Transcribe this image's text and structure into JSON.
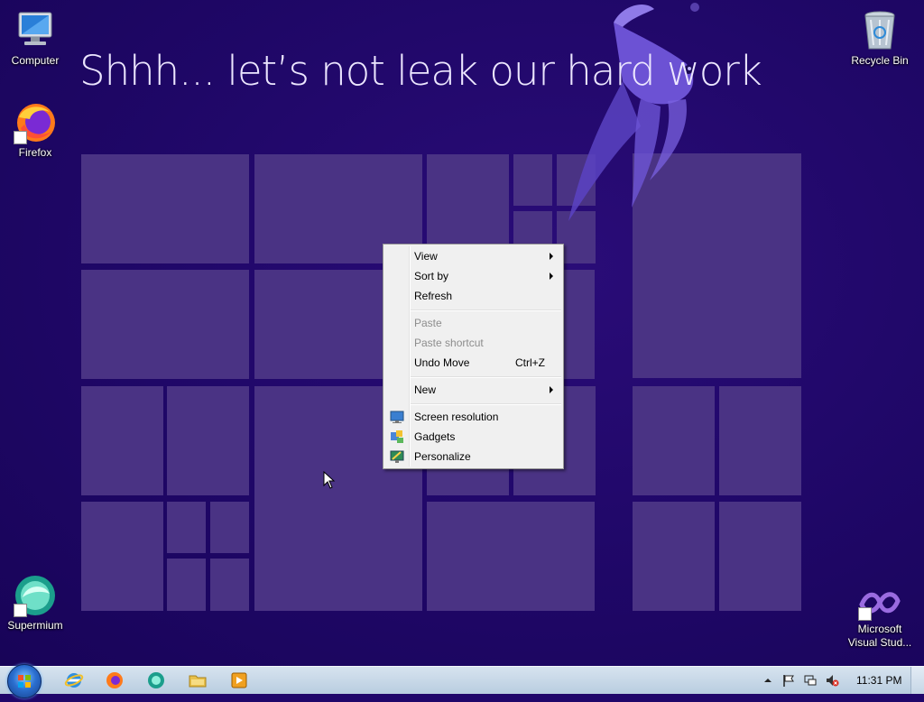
{
  "wallpaper": {
    "headline": "Shhh... let’s not leak our hard work"
  },
  "desktop_icons": [
    {
      "label": "Computer",
      "icon": "computer-icon"
    },
    {
      "label": "Firefox",
      "icon": "firefox-icon"
    },
    {
      "label": "Supermium",
      "icon": "supermium-icon"
    },
    {
      "label": "Recycle Bin",
      "icon": "recycle-bin-icon"
    },
    {
      "label_line1": "Microsoft",
      "label_line2": "Visual Stud...",
      "icon": "visual-studio-icon"
    }
  ],
  "context_menu": {
    "items": [
      {
        "label": "View",
        "submenu": true,
        "enabled": true
      },
      {
        "label": "Sort by",
        "submenu": true,
        "enabled": true
      },
      {
        "label": "Refresh",
        "enabled": true
      },
      {
        "label": "Paste",
        "enabled": false
      },
      {
        "label": "Paste shortcut",
        "enabled": false
      },
      {
        "label": "Undo Move",
        "shortcut": "Ctrl+Z",
        "enabled": true
      },
      {
        "label": "New",
        "submenu": true,
        "enabled": true
      },
      {
        "label": "Screen resolution",
        "icon": "screen-resolution-icon",
        "enabled": true
      },
      {
        "label": "Gadgets",
        "icon": "gadgets-icon",
        "enabled": true
      },
      {
        "label": "Personalize",
        "icon": "personalize-icon",
        "enabled": true
      }
    ]
  },
  "taskbar": {
    "pinned": [
      "internet-explorer-icon",
      "firefox-icon",
      "supermium-icon",
      "file-explorer-icon",
      "media-player-icon"
    ],
    "tray": [
      "show-hidden-icons-arrow",
      "action-center-flag-icon",
      "network-icon",
      "volume-muted-icon"
    ],
    "clock": "11:31 PM"
  },
  "colors": {
    "desktop_background": "#20066a",
    "tile": "#4a3384",
    "menu_background": "#f0f0f0",
    "taskbar": "#c7d7e8"
  }
}
